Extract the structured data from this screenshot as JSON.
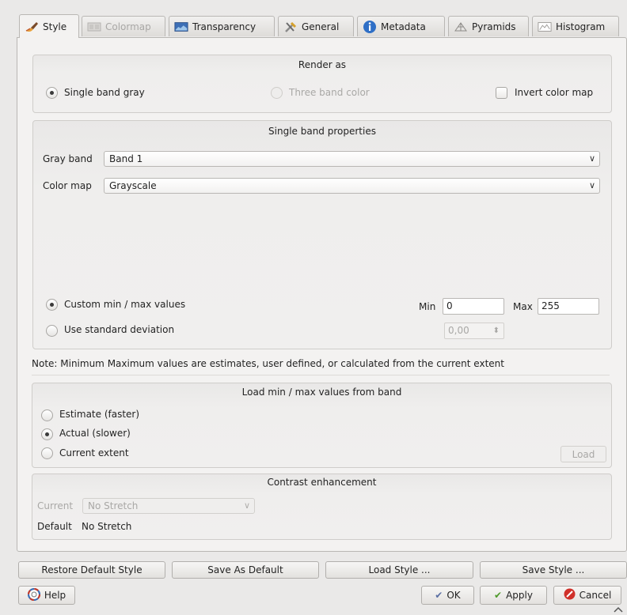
{
  "tabs": [
    {
      "label": "Style",
      "icon": "paint-brush-icon"
    },
    {
      "label": "Colormap",
      "icon": "colormap-icon"
    },
    {
      "label": "Transparency",
      "icon": "transparency-icon"
    },
    {
      "label": "General",
      "icon": "tools-icon"
    },
    {
      "label": "Metadata",
      "icon": "info-icon"
    },
    {
      "label": "Pyramids",
      "icon": "pyramid-icon"
    },
    {
      "label": "Histogram",
      "icon": "histogram-icon"
    }
  ],
  "render_as": {
    "title": "Render as",
    "single_band_gray": "Single band gray",
    "three_band_color": "Three band color",
    "invert_color_map": "Invert color map"
  },
  "single_band": {
    "title": "Single band properties",
    "gray_band_label": "Gray band",
    "gray_band_value": "Band 1",
    "color_map_label": "Color map",
    "color_map_value": "Grayscale",
    "custom_minmax": "Custom min / max values",
    "std_dev": "Use standard deviation",
    "min_label": "Min",
    "min_value": "0",
    "max_label": "Max",
    "max_value": "255",
    "std_dev_value": "0,00"
  },
  "note": "Note: Minimum Maximum values are estimates, user defined, or calculated from the current extent",
  "load_minmax": {
    "title": "Load min / max values from band",
    "estimate": "Estimate (faster)",
    "actual": "Actual (slower)",
    "current_extent": "Current extent",
    "load_button": "Load"
  },
  "contrast": {
    "title": "Contrast enhancement",
    "current_label": "Current",
    "current_value": "No Stretch",
    "default_label": "Default",
    "default_value": "No Stretch"
  },
  "style_buttons": {
    "restore": "Restore Default Style",
    "save_default": "Save As Default",
    "load": "Load Style ...",
    "save": "Save Style ..."
  },
  "dialog_buttons": {
    "help": "Help",
    "ok": "OK",
    "apply": "Apply",
    "cancel": "Cancel"
  }
}
